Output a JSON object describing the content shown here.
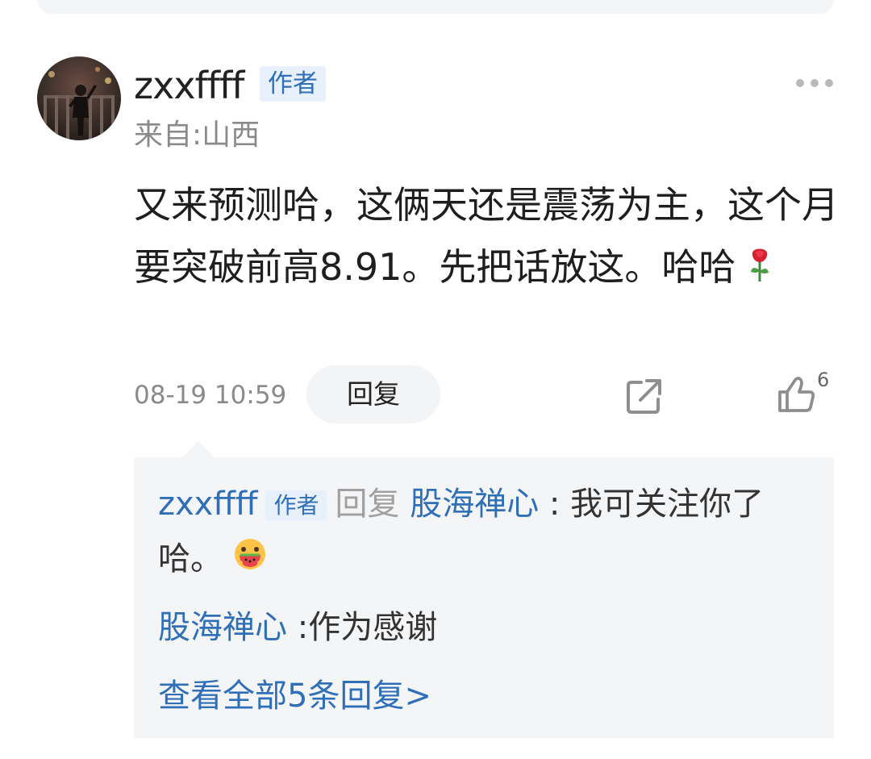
{
  "comment": {
    "username": "zxxffff",
    "author_badge": "作者",
    "location": "来自:山西",
    "text": "又来预测哈，这俩天还是震荡为主，这个月要突破前高8.91。先把话放这。哈哈",
    "timestamp": "08-19 10:59",
    "reply_label": "回复",
    "like_count": "6"
  },
  "replies": [
    {
      "author": "zxxffff",
      "author_badge": "作者",
      "reply_word": "回复",
      "target": "股海禅心",
      "colon": ":",
      "text": "我可关注你了哈。"
    },
    {
      "author": "股海禅心",
      "colon": ":",
      "text": "作为感谢"
    }
  ],
  "view_all_replies": "查看全部5条回复>",
  "icons": {
    "more": "more-icon",
    "share": "share-icon",
    "like": "thumbs-up-icon",
    "emoji_flower": "rose-icon",
    "emoji_face": "watermelon-face-icon"
  },
  "colors": {
    "link_blue": "#2f6fb8",
    "badge_bg": "#e8f0fb",
    "reply_box_bg": "#f4f5f7",
    "muted_text": "#8a8a8a"
  }
}
